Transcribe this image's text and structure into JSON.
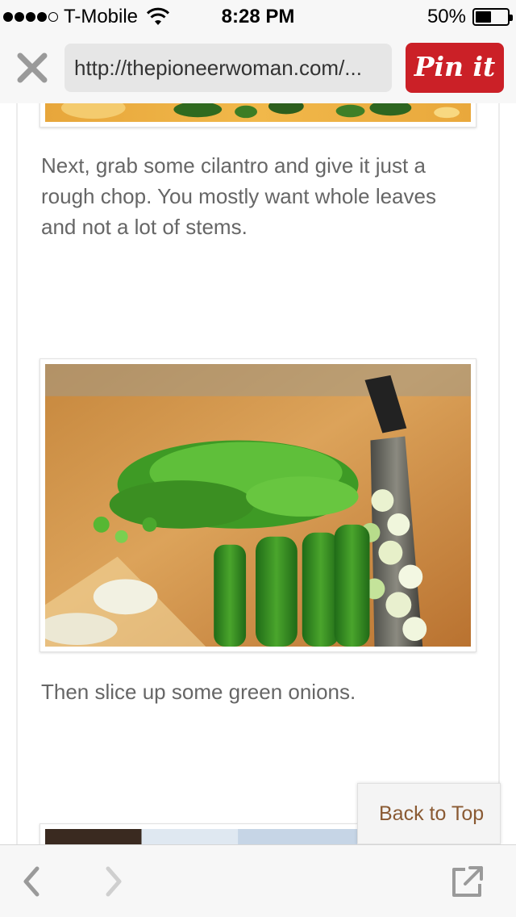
{
  "status_bar": {
    "carrier": "T-Mobile",
    "time": "8:28 PM",
    "battery_percent": "50%",
    "battery_level": 0.5,
    "signal_bars": 4,
    "signal_total": 5
  },
  "browser": {
    "url": "http://thepioneerwoman.com/...",
    "close_icon": "close-icon",
    "pin_label": "Pin it",
    "pin_color": "#cb2027"
  },
  "article": {
    "paragraphs": [
      "Next, grab some cilantro and give it just a rough chop. You mostly want whole leaves and not a lot of stems.",
      "Then slice up some green onions."
    ],
    "text_color": "#666666"
  },
  "back_to_top": "Back to Top",
  "back_to_top_color": "#8a5a33",
  "toolbar": {
    "back_icon": "chevron-left-icon",
    "forward_icon": "chevron-right-icon",
    "share_icon": "open-external-icon"
  }
}
